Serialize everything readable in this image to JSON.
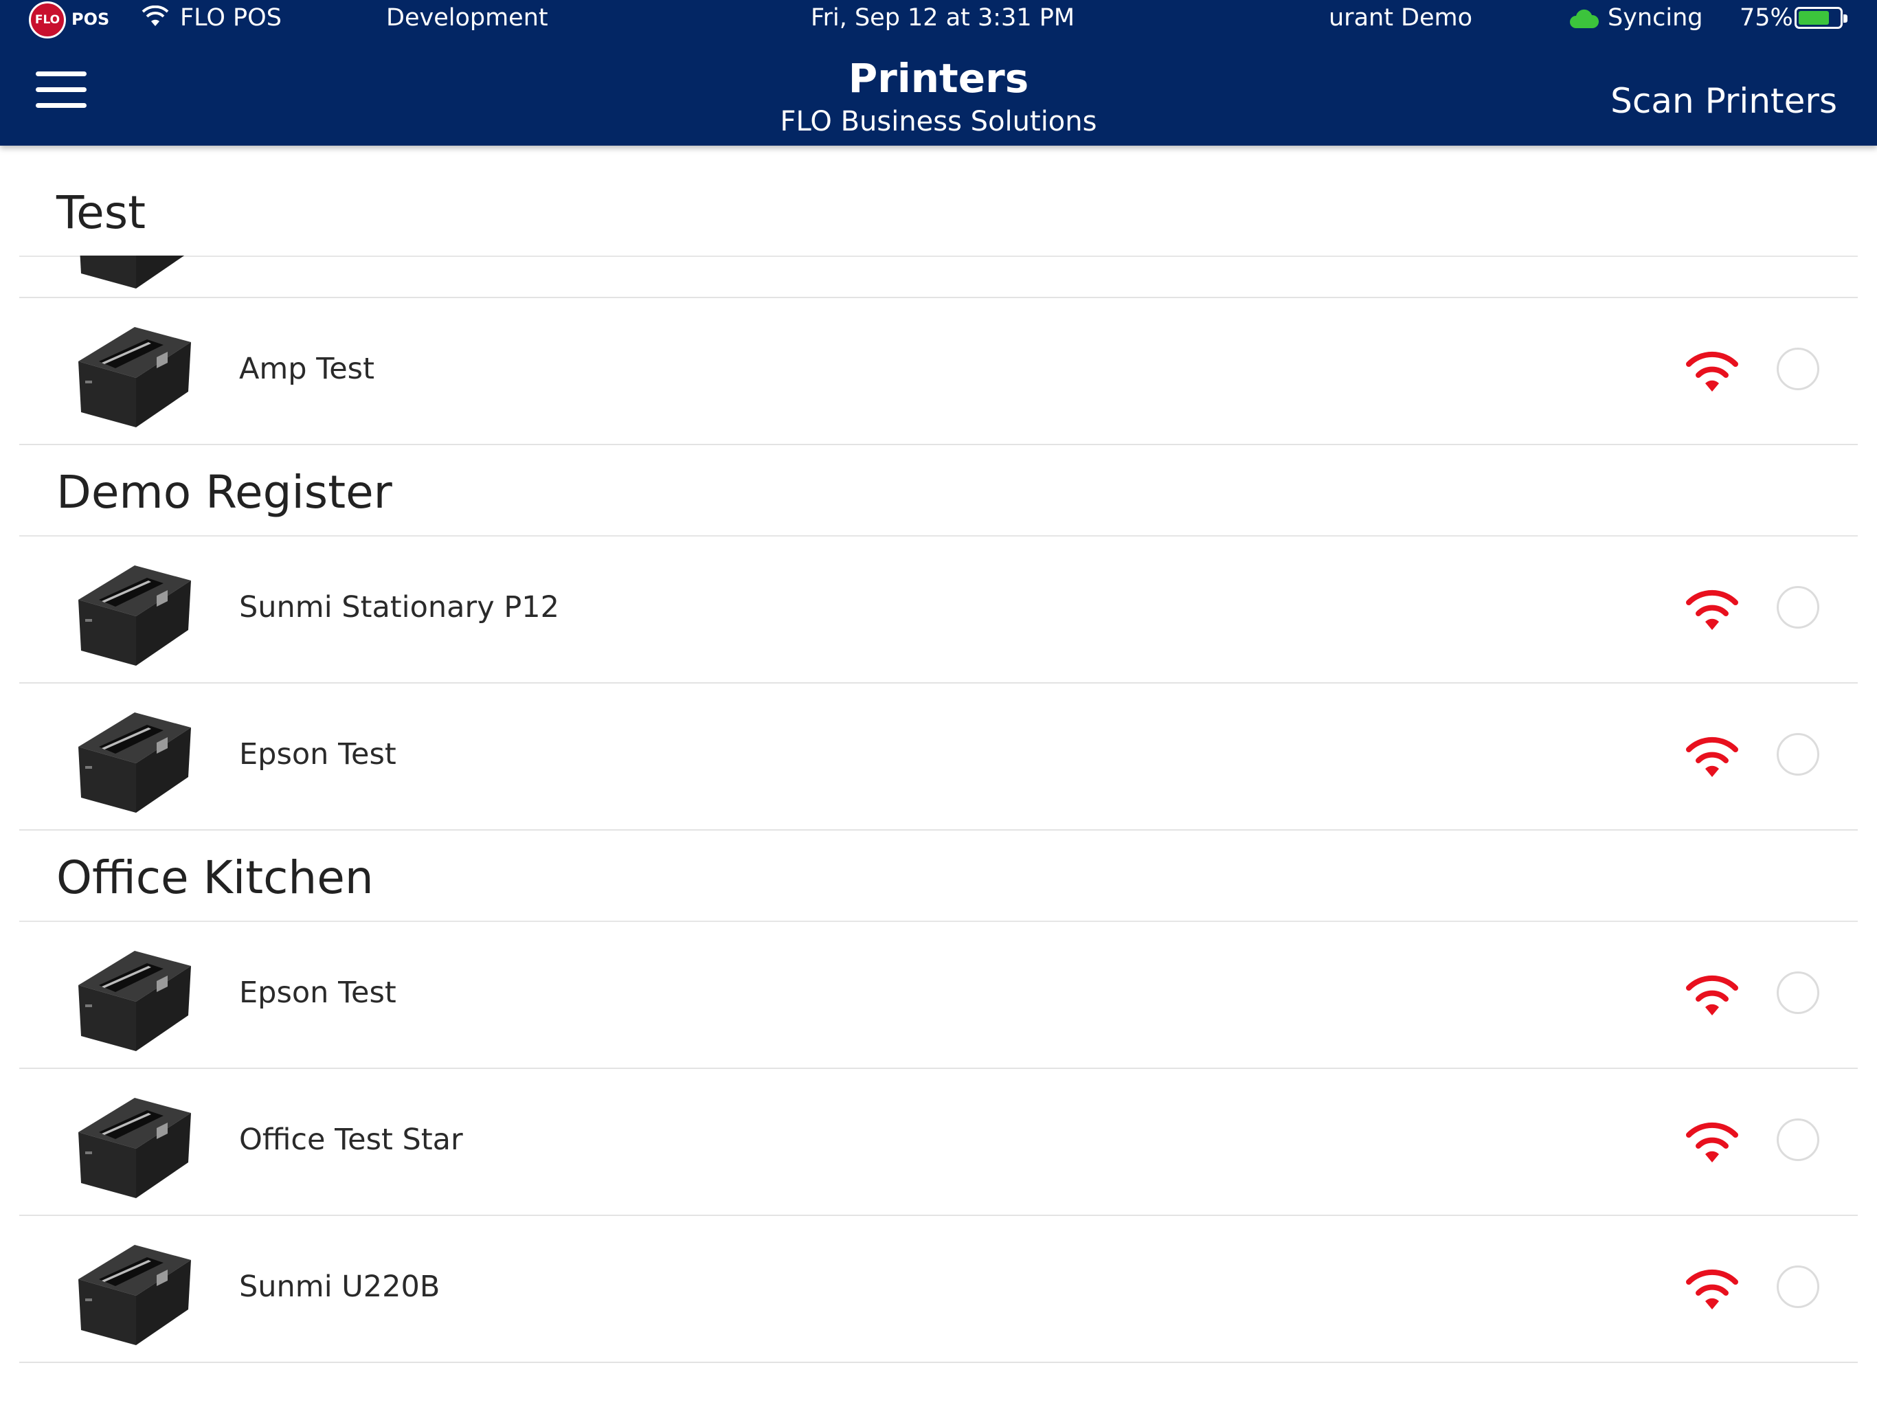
{
  "status_bar": {
    "logo_text": "FLO",
    "logo_suffix": "POS",
    "wifi_name": "FLO POS",
    "environment": "Development",
    "datetime": "Fri, Sep 12 at 3:31 PM",
    "restaurant": "urant Demo",
    "sync": "Syncing",
    "battery": "75%",
    "battery_level": 0.75
  },
  "header": {
    "title": "Printers",
    "subtitle": "FLO Business Solutions",
    "scan_label": "Scan Printers"
  },
  "sections": [
    {
      "label": "Test",
      "printers": [
        {
          "name": ""
        },
        {
          "name": "Amp Test"
        }
      ]
    },
    {
      "label": "Demo Register",
      "printers": [
        {
          "name": "Sunmi Stationary P12"
        },
        {
          "name": "Epson Test"
        }
      ]
    },
    {
      "label": "Office Kitchen",
      "printers": [
        {
          "name": "Epson Test"
        },
        {
          "name": "Office Test Star"
        },
        {
          "name": "Sunmi U220B"
        }
      ]
    }
  ],
  "colors": {
    "header_bg": "#032664",
    "wifi_icon": "#e8101e",
    "battery_fill": "#3cc43c"
  },
  "icons": {
    "printer": "receipt-printer-icon",
    "connection": "wifi-icon",
    "menu": "hamburger-menu-icon"
  }
}
